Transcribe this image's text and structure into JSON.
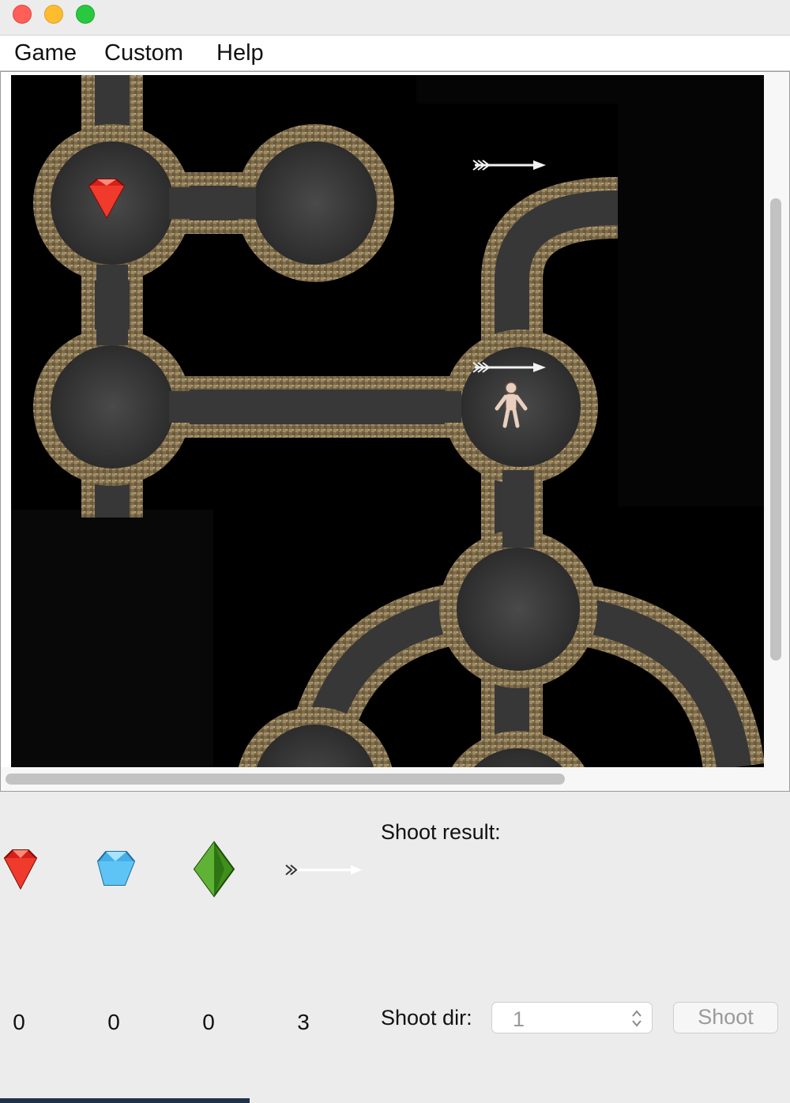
{
  "window": {
    "controls": [
      "close",
      "minimize",
      "zoom"
    ]
  },
  "menubar": {
    "items": [
      "Game",
      "Custom",
      "Help"
    ]
  },
  "map": {
    "items_visible": [
      {
        "icon": "ruby-gem-icon"
      },
      {
        "icon": "arrow-pickup-icon"
      },
      {
        "icon": "arrow-pickup-icon"
      },
      {
        "icon": "player-character-icon"
      }
    ]
  },
  "inventory": {
    "ruby_count": "0",
    "sapphire_count": "0",
    "emerald_count": "0",
    "arrow_count": "3"
  },
  "shoot": {
    "result_label": "Shoot result:",
    "result_value": "",
    "dir_label": "Shoot dir:",
    "dir_value": "1",
    "button_label": "Shoot"
  },
  "colors": {
    "ruby": "#e0221c",
    "sapphire": "#4fb8f0",
    "emerald": "#3f8f1c",
    "wall_stone": "#8a7a5a",
    "floor": "#3a3a3a",
    "background": "#000000"
  }
}
